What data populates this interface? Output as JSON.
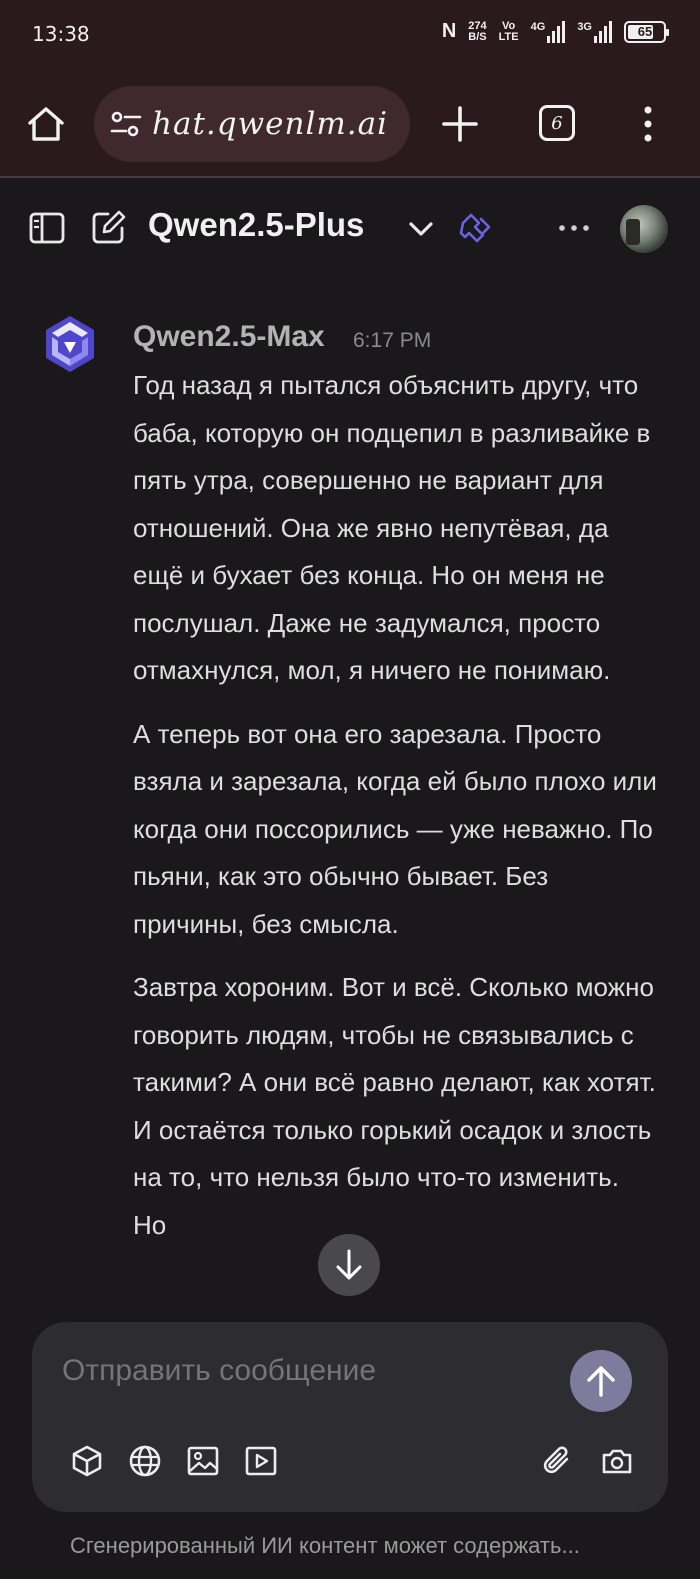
{
  "status_bar": {
    "time": "13:38",
    "data_rate_value": "274",
    "data_rate_unit": "B/S",
    "volte_top": "Vo",
    "volte_bottom": "LTE",
    "net_1": "4G",
    "net_2": "3G",
    "battery_level": "65"
  },
  "browser": {
    "url": "hat.qwenlm.ai",
    "tab_count": "6"
  },
  "header": {
    "model_name": "Qwen2.5-Plus"
  },
  "message": {
    "author": "Qwen2.5-Max",
    "time": "6:17 PM",
    "paragraphs": [
      "Год назад я пытался объяснить другу, что баба, которую он подцепил в разливайке в пять утра, совершенно не вариант для отношений. Она же явно непутёвая, да ещё и бухает без конца. Но он меня не послушал. Даже не задумался, просто отмахнулся, мол, я ничего не понимаю.",
      "А теперь вот она его зарезала. Просто взяла и зарезала, когда ей было плохо или когда они поссорились — уже неважно. По пьяни, как это обычно бывает. Без причины, без смысла.",
      "Завтра хороним. Вот и всё. Сколько можно говорить людям, чтобы не связывались с такими? А они всё равно делают, как хотят. И остаётся только горький осадок и злость на то, что нельзя было что-то изменить. Но"
    ]
  },
  "composer": {
    "placeholder": "Отправить сообщение"
  },
  "footer": {
    "disclaimer": "Сгенерированный ИИ контент может содержать..."
  },
  "colors": {
    "background": "#1a181b",
    "browser_chrome": "#2a1a1e",
    "composer": "#2d2c31",
    "send_button": "#7f7b9c",
    "accent_logo": "#615ced"
  },
  "icons": [
    "home-icon",
    "site-settings-icon",
    "plus-icon",
    "tabs-icon",
    "overflow-menu-icon",
    "sidebar-icon",
    "new-chat-icon",
    "chevron-down-icon",
    "feature-icon",
    "more-icon",
    "qwen-logo-icon",
    "arrow-down-icon",
    "arrow-up-icon",
    "cube-icon",
    "globe-icon",
    "image-icon",
    "video-icon",
    "paperclip-icon",
    "camera-icon"
  ]
}
